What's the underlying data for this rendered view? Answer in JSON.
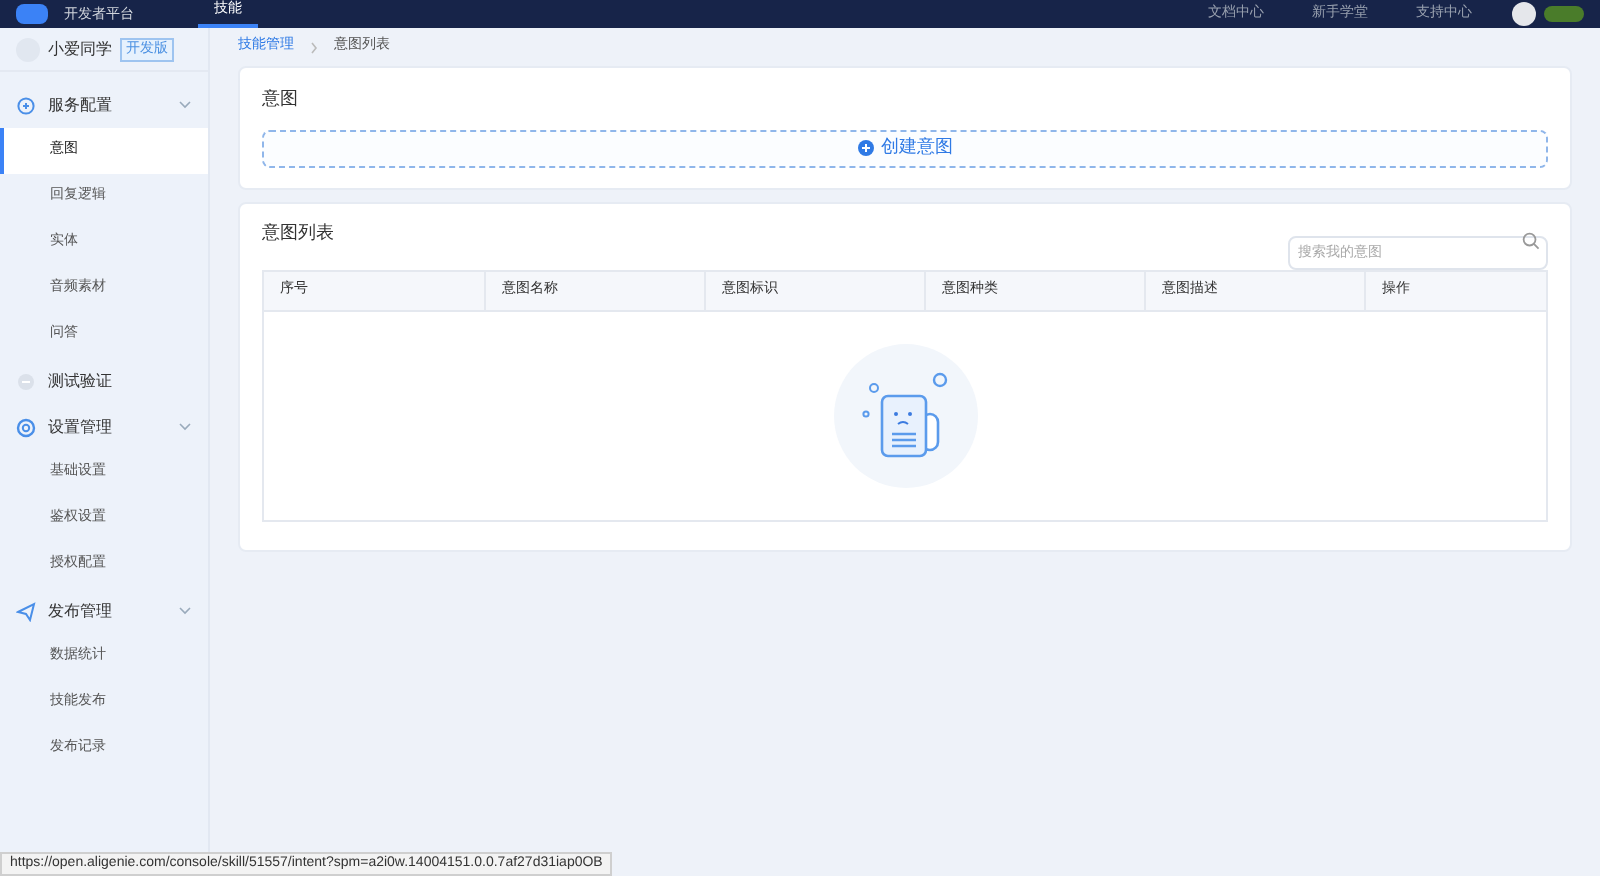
{
  "top_bar": {
    "platform": "开发者平台",
    "tabs": [
      {
        "label": "技能",
        "selected": true
      }
    ],
    "links": [
      "文档中心",
      "新手学堂",
      "支持中心"
    ]
  },
  "skill": {
    "name": "小爱同学",
    "badge": "开发版"
  },
  "sidebar": {
    "groups": [
      {
        "label": "服务配置",
        "kind": "service",
        "expandable": true,
        "children": [
          {
            "label": "意图",
            "selected": true
          },
          {
            "label": "回复逻辑",
            "selected": false
          },
          {
            "label": "实体",
            "selected": false
          },
          {
            "label": "音频素材",
            "selected": false
          },
          {
            "label": "问答",
            "selected": false
          }
        ]
      },
      {
        "label": "测试验证",
        "kind": "test",
        "expandable": false
      },
      {
        "label": "设置管理",
        "kind": "settings",
        "expandable": true,
        "children": [
          {
            "label": "基础设置",
            "selected": false
          },
          {
            "label": "鉴权设置",
            "selected": false
          },
          {
            "label": "授权配置",
            "selected": false
          }
        ]
      },
      {
        "label": "发布管理",
        "kind": "publish",
        "expandable": true,
        "children": [
          {
            "label": "数据统计",
            "selected": false
          },
          {
            "label": "技能发布",
            "selected": false
          },
          {
            "label": "发布记录",
            "selected": false
          }
        ]
      }
    ]
  },
  "breadcrumb": [
    "技能管理",
    "意图列表"
  ],
  "intent_card": {
    "title": "意图",
    "create_button": "创建意图"
  },
  "intent_list": {
    "title": "意图列表",
    "search": {
      "placeholder": "搜索我的意图"
    },
    "table": {
      "columns": [
        "序号",
        "意图名称",
        "意图标识",
        "意图种类",
        "意图描述",
        "操作"
      ]
    }
  },
  "status_url": "https://open.aligenie.com/console/skill/51557/intent?spm=a2i0w.14004151.0.0.7af27d31iap0OB"
}
